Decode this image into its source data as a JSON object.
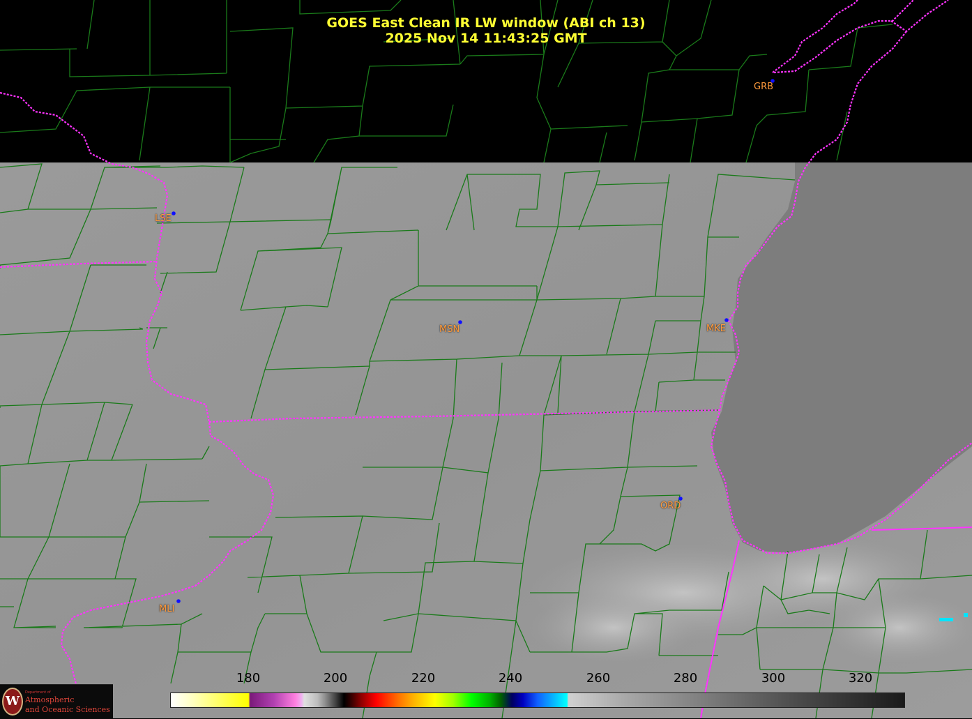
{
  "title_line1": "GOES East Clean IR LW window (ABI ch 13)",
  "title_line2": "2025 Nov 14  11:43:25 GMT",
  "cities": [
    {
      "code": "GRB",
      "color": "#ff9a3c"
    },
    {
      "code": "LSE",
      "color": "#ff9a3c"
    },
    {
      "code": "MSN",
      "color": "#ff9a3c"
    },
    {
      "code": "MKE",
      "color": "#ff9a3c"
    },
    {
      "code": "ORD",
      "color": "#ff9a3c"
    },
    {
      "code": "MLI",
      "color": "#ff9a3c"
    }
  ],
  "colorbar": {
    "ticks": [
      "180",
      "200",
      "220",
      "240",
      "260",
      "280",
      "300",
      "320"
    ],
    "min": 163,
    "max": 330
  },
  "logo": {
    "dept_small": "Department of",
    "line1": "Atmospheric",
    "line2": "and Oceanic Sciences",
    "seal_letter": "W"
  },
  "colors": {
    "county_lines": "#1a7a1a",
    "state_lines": "#ff33ff",
    "title": "#ffff33",
    "city_dot": "#1010ff"
  }
}
